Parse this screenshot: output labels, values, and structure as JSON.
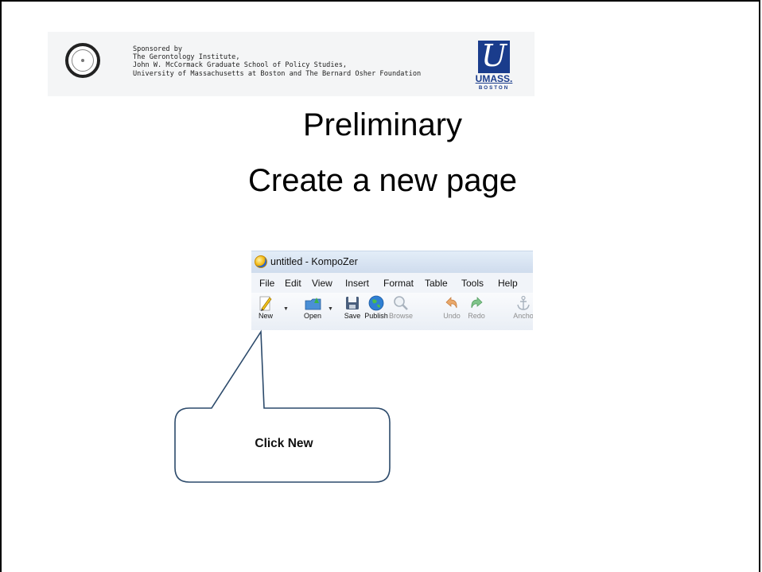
{
  "banner": {
    "sponsor_lines": [
      "Sponsored by",
      "The Gerontology Institute,",
      "John W. McCormack Graduate School of Policy Studies,",
      "University of Massachusetts at Boston and The Bernard Osher Foundation"
    ],
    "osher_logo": "osher-lifelong-learning-institute-logo",
    "umass_logo": {
      "wordmark": "UMASS.",
      "sub": "BOSTON",
      "color": "#1a3c8c"
    }
  },
  "title": {
    "line1": "Preliminary",
    "line2": "Create a new page"
  },
  "screenshot": {
    "window_title": "untitled - KompoZer",
    "menu": [
      "File",
      "Edit",
      "View",
      "Insert",
      "Format",
      "Table",
      "Tools",
      "Help"
    ],
    "toolbar": [
      {
        "label": "New",
        "icon": "new-page-pencil-icon",
        "enabled": true
      },
      {
        "label": "Open",
        "icon": "open-folder-icon",
        "enabled": true
      },
      {
        "label": "Save",
        "icon": "save-disk-icon",
        "enabled": true
      },
      {
        "label": "Publish",
        "icon": "publish-globe-icon",
        "enabled": true
      },
      {
        "label": "Browse",
        "icon": "browse-magnifier-icon",
        "enabled": false
      },
      {
        "label": "Undo",
        "icon": "undo-arrow-icon",
        "enabled": false
      },
      {
        "label": "Redo",
        "icon": "redo-arrow-icon",
        "enabled": false
      },
      {
        "label": "Ancho",
        "icon": "anchor-icon",
        "enabled": false
      }
    ]
  },
  "callout": {
    "text": "Click New"
  }
}
